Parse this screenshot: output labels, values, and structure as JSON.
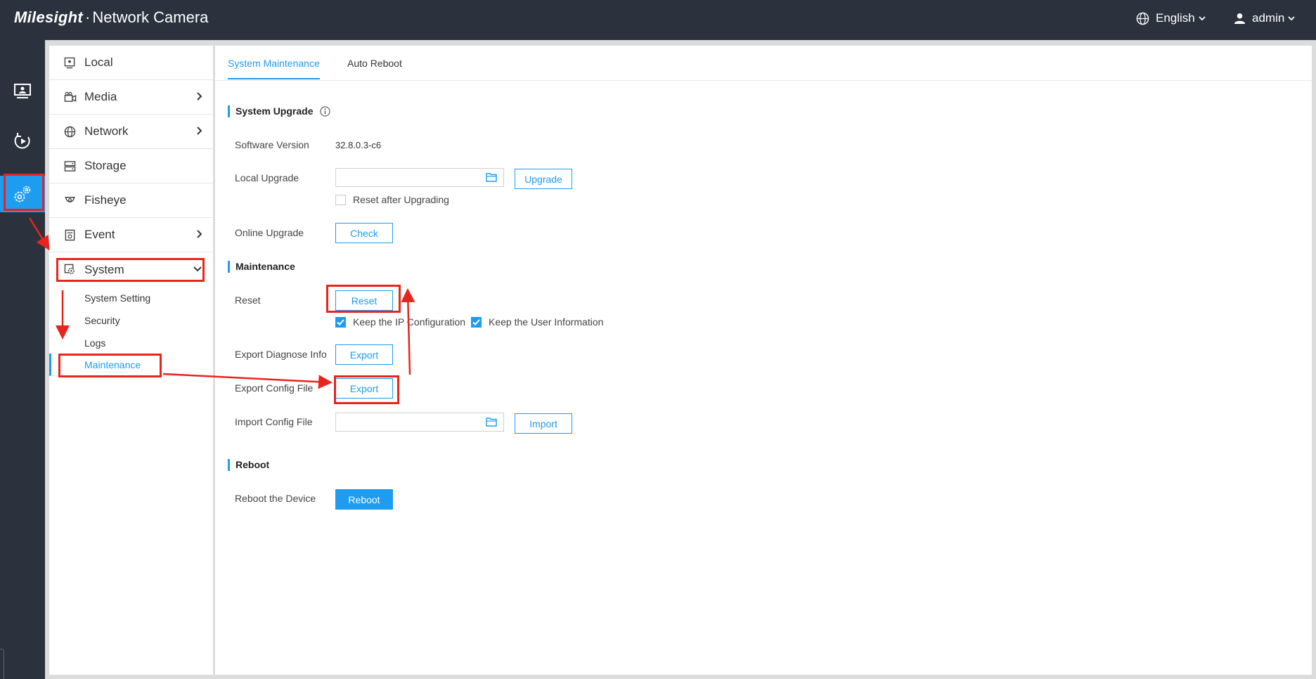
{
  "header": {
    "brand_logo": "Milesight",
    "brand_separator": "·",
    "app_title": "Network Camera",
    "language": "English",
    "user": "admin"
  },
  "rail": [
    {
      "icon": "live-view-icon",
      "active": false
    },
    {
      "icon": "playback-icon",
      "active": false
    },
    {
      "icon": "settings-icon",
      "active": true
    }
  ],
  "sidebar": {
    "items": [
      {
        "label": "Local",
        "icon": "local-icon",
        "has_children": false
      },
      {
        "label": "Media",
        "icon": "media-icon",
        "has_children": true
      },
      {
        "label": "Network",
        "icon": "network-icon",
        "has_children": true
      },
      {
        "label": "Storage",
        "icon": "storage-icon",
        "has_children": false
      },
      {
        "label": "Fisheye",
        "icon": "fisheye-icon",
        "has_children": false
      },
      {
        "label": "Event",
        "icon": "event-icon",
        "has_children": true
      },
      {
        "label": "System",
        "icon": "system-icon",
        "has_children": true,
        "expanded": true
      }
    ],
    "system_subitems": [
      {
        "label": "System Setting",
        "active": false
      },
      {
        "label": "Security",
        "active": false
      },
      {
        "label": "Logs",
        "active": false
      },
      {
        "label": "Maintenance",
        "active": true
      }
    ]
  },
  "tabs": [
    {
      "label": "System Maintenance",
      "active": true
    },
    {
      "label": "Auto Reboot",
      "active": false
    }
  ],
  "upgrade": {
    "title": "System Upgrade",
    "software_version_label": "Software Version",
    "software_version": "32.8.0.3-c6",
    "local_upgrade_label": "Local Upgrade",
    "local_upgrade_value": "",
    "upgrade_button": "Upgrade",
    "reset_after_upgrading": "Reset after Upgrading",
    "reset_after_upgrading_checked": false,
    "online_upgrade_label": "Online Upgrade",
    "check_button": "Check"
  },
  "maintenance": {
    "title": "Maintenance",
    "reset_label": "Reset",
    "reset_button": "Reset",
    "keep_ip_label": "Keep the IP Configuration",
    "keep_ip_checked": true,
    "keep_user_label": "Keep the User Information",
    "keep_user_checked": true,
    "export_diagnose_label": "Export Diagnose Info",
    "export_diagnose_button": "Export",
    "export_config_label": "Export Config File",
    "export_config_button": "Export",
    "import_config_label": "Import Config File",
    "import_config_value": "",
    "import_button": "Import"
  },
  "reboot": {
    "title": "Reboot",
    "reboot_label": "Reboot the Device",
    "reboot_button": "Reboot"
  },
  "colors": {
    "accent": "#1d9cf0",
    "topbar": "#2c323d",
    "annotation": "#e8241e"
  }
}
